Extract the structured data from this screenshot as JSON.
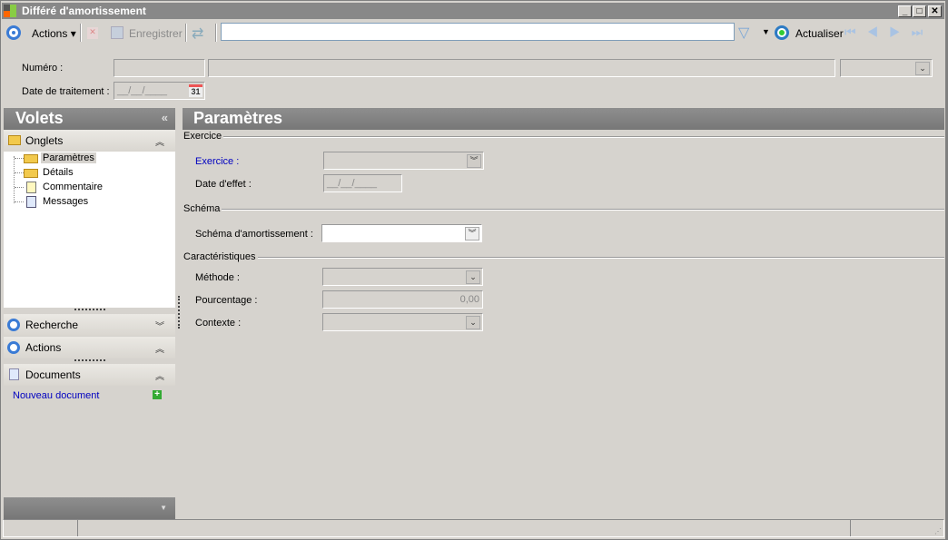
{
  "window": {
    "title": "Différé d'amortissement",
    "min": "_",
    "max": "□",
    "close": "✕"
  },
  "toolbar": {
    "actions": "Actions",
    "save": "Enregistrer",
    "search_value": "",
    "refresh": "Actualiser"
  },
  "header": {
    "numero_label": "Numéro :",
    "date_label": "Date de traitement :",
    "date_value": "__/__/____",
    "calendar_day": "31"
  },
  "sidebar": {
    "title": "Volets",
    "collapse": "«",
    "onglets": "Onglets",
    "items": [
      {
        "label": "Paramètres"
      },
      {
        "label": "Détails"
      },
      {
        "label": "Commentaire"
      },
      {
        "label": "Messages"
      }
    ],
    "recherche": "Recherche",
    "actions": "Actions",
    "documents": "Documents",
    "new_document": "Nouveau document"
  },
  "main": {
    "title": "Paramètres",
    "exercice_group": "Exercice",
    "exercice_label": "Exercice :",
    "date_effet_label": "Date d'effet :",
    "date_effet_value": "__/__/____",
    "schema_group": "Schéma",
    "schema_label": "Schéma d'amortissement :",
    "carac_group": "Caractéristiques",
    "methode_label": "Méthode :",
    "pourcentage_label": "Pourcentage :",
    "pourcentage_value": "0,00",
    "contexte_label": "Contexte :"
  }
}
